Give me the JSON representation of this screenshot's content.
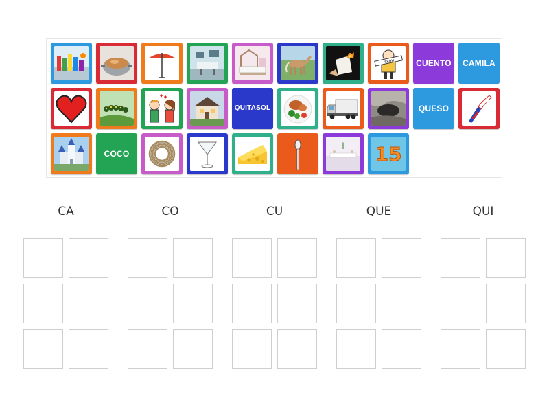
{
  "tiles": [
    {
      "name": "tile-chemistry-lab-image",
      "kind": "image",
      "icon": "chemistry-lab-image",
      "color": "#2d9ae0"
    },
    {
      "name": "tile-cooking-pot-image",
      "kind": "image",
      "icon": "cooking-pot-image",
      "color": "#d92b36"
    },
    {
      "name": "tile-parasol-image",
      "kind": "image",
      "icon": "parasol-image",
      "color": "#f07b1d"
    },
    {
      "name": "tile-hospital-room-image",
      "kind": "image",
      "icon": "hospital-room-image",
      "color": "#23a455"
    },
    {
      "name": "tile-house-bed-image",
      "kind": "image",
      "icon": "house-bed-image",
      "color": "#c75bc7"
    },
    {
      "name": "tile-horse-image",
      "kind": "image",
      "icon": "horse-image",
      "color": "#2a39c9"
    },
    {
      "name": "tile-burning-paper-image",
      "kind": "image",
      "icon": "burning-paper-image",
      "color": "#30b08a"
    },
    {
      "name": "tile-child-sign-image",
      "kind": "image",
      "icon": "child-sign-image",
      "color": "#ea5a1a"
    },
    {
      "name": "tile-word-cuento",
      "kind": "word",
      "text": "CUENTO",
      "color": "#8c3ad9"
    },
    {
      "name": "tile-word-camila",
      "kind": "word",
      "text": "CAMILA",
      "color": "#2d9ae0"
    },
    {
      "name": "tile-heart-image",
      "kind": "image",
      "icon": "heart-image",
      "color": "#d92b36"
    },
    {
      "name": "tile-caterpillar-image",
      "kind": "image",
      "icon": "caterpillar-image",
      "color": "#f07b1d"
    },
    {
      "name": "tile-kiss-image",
      "kind": "image",
      "icon": "kiss-image",
      "color": "#23a455"
    },
    {
      "name": "tile-house-image",
      "kind": "image",
      "icon": "house-image",
      "color": "#c75bc7"
    },
    {
      "name": "tile-word-quitasol",
      "kind": "word",
      "text": "QUITASOL",
      "color": "#2a39c9",
      "small": true
    },
    {
      "name": "tile-food-plate-image",
      "kind": "image",
      "icon": "food-plate-image",
      "color": "#30b08a"
    },
    {
      "name": "tile-truck-image",
      "kind": "image",
      "icon": "truck-image",
      "color": "#ea5a1a"
    },
    {
      "name": "tile-cave-image",
      "kind": "image",
      "icon": "cave-image",
      "color": "#8c3ad9"
    },
    {
      "name": "tile-word-queso",
      "kind": "word",
      "text": "QUESO",
      "color": "#2d9ae0"
    },
    {
      "name": "tile-chile-map-image",
      "kind": "image",
      "icon": "chile-map-image",
      "color": "#d92b36"
    },
    {
      "name": "tile-castle-image",
      "kind": "image",
      "icon": "castle-image",
      "color": "#f07b1d"
    },
    {
      "name": "tile-word-coco",
      "kind": "word",
      "text": "COCO",
      "color": "#23a455"
    },
    {
      "name": "tile-rope-image",
      "kind": "image",
      "icon": "rope-image",
      "color": "#c75bc7"
    },
    {
      "name": "tile-cocktail-glass-image",
      "kind": "image",
      "icon": "cocktail-glass-image",
      "color": "#2a39c9"
    },
    {
      "name": "tile-cheese-image",
      "kind": "image",
      "icon": "cheese-image",
      "color": "#30b08a"
    },
    {
      "name": "tile-spoon-image",
      "kind": "image",
      "icon": "spoon-image",
      "color": "#ea5a1a",
      "nopic": true
    },
    {
      "name": "tile-party-room-image",
      "kind": "image",
      "icon": "party-room-image",
      "color": "#8c3ad9"
    },
    {
      "name": "tile-fifteen-image",
      "kind": "image",
      "icon": "fifteen-image",
      "color": "#2d9ae0",
      "text": "15"
    }
  ],
  "columns": [
    {
      "title": "CA"
    },
    {
      "title": "CO"
    },
    {
      "title": "CU"
    },
    {
      "title": "QUE"
    },
    {
      "title": "QUI"
    }
  ]
}
